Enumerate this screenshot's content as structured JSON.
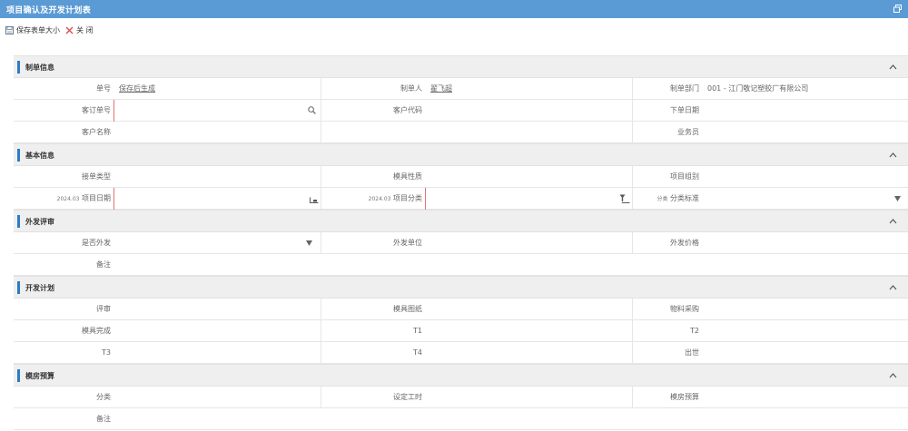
{
  "window": {
    "title": "项目确认及开发计划表"
  },
  "toolbar": {
    "save_label": "保存表单大小",
    "close_label": "关 闭"
  },
  "sections": {
    "maker": {
      "title": "制单信息",
      "bill_no_label": "单号",
      "bill_no_value": "保存后生成",
      "maker_label": "制单人",
      "maker_value": "翟飞超",
      "dept_label": "制单部门",
      "dept_value": "001 - 江门敬记塑胶厂有限公司",
      "order_no_label": "客订单号",
      "customer_code_label": "客户代码",
      "order_date_label": "下单日期",
      "customer_name_label": "客户名称",
      "salesman_label": "业务员"
    },
    "basic": {
      "title": "基本信息",
      "order_type_label": "接单类型",
      "mold_nature_label": "模具性质",
      "project_group_label": "项目组别",
      "project_start_label": "项目日期",
      "project_start_sub": "2024.03",
      "project_cat_label": "项目分类",
      "project_cat_sub": "2024.03",
      "category_label": "分类标准",
      "category_sub": "分类"
    },
    "outsource": {
      "title": "外发评审",
      "is_outsource_label": "是否外发",
      "outsource_unit_label": "外发单位",
      "outsource_price_label": "外发价格",
      "remark_label": "备注"
    },
    "plan": {
      "title": "开发计划",
      "review_label": "评审",
      "mold_drawing_label": "模具图纸",
      "material_purchase_label": "物料采购",
      "mold_complete_label": "模具完成",
      "t1_label": "T1",
      "t2_label": "T2",
      "t3_label": "T3",
      "t4_label": "T4",
      "ship_label": "出世"
    },
    "budget": {
      "title": "模房预算",
      "classify_label": "分类",
      "set_hours_label": "设定工时",
      "mold_budget_label": "模房预算",
      "remark_label": "备注"
    }
  }
}
